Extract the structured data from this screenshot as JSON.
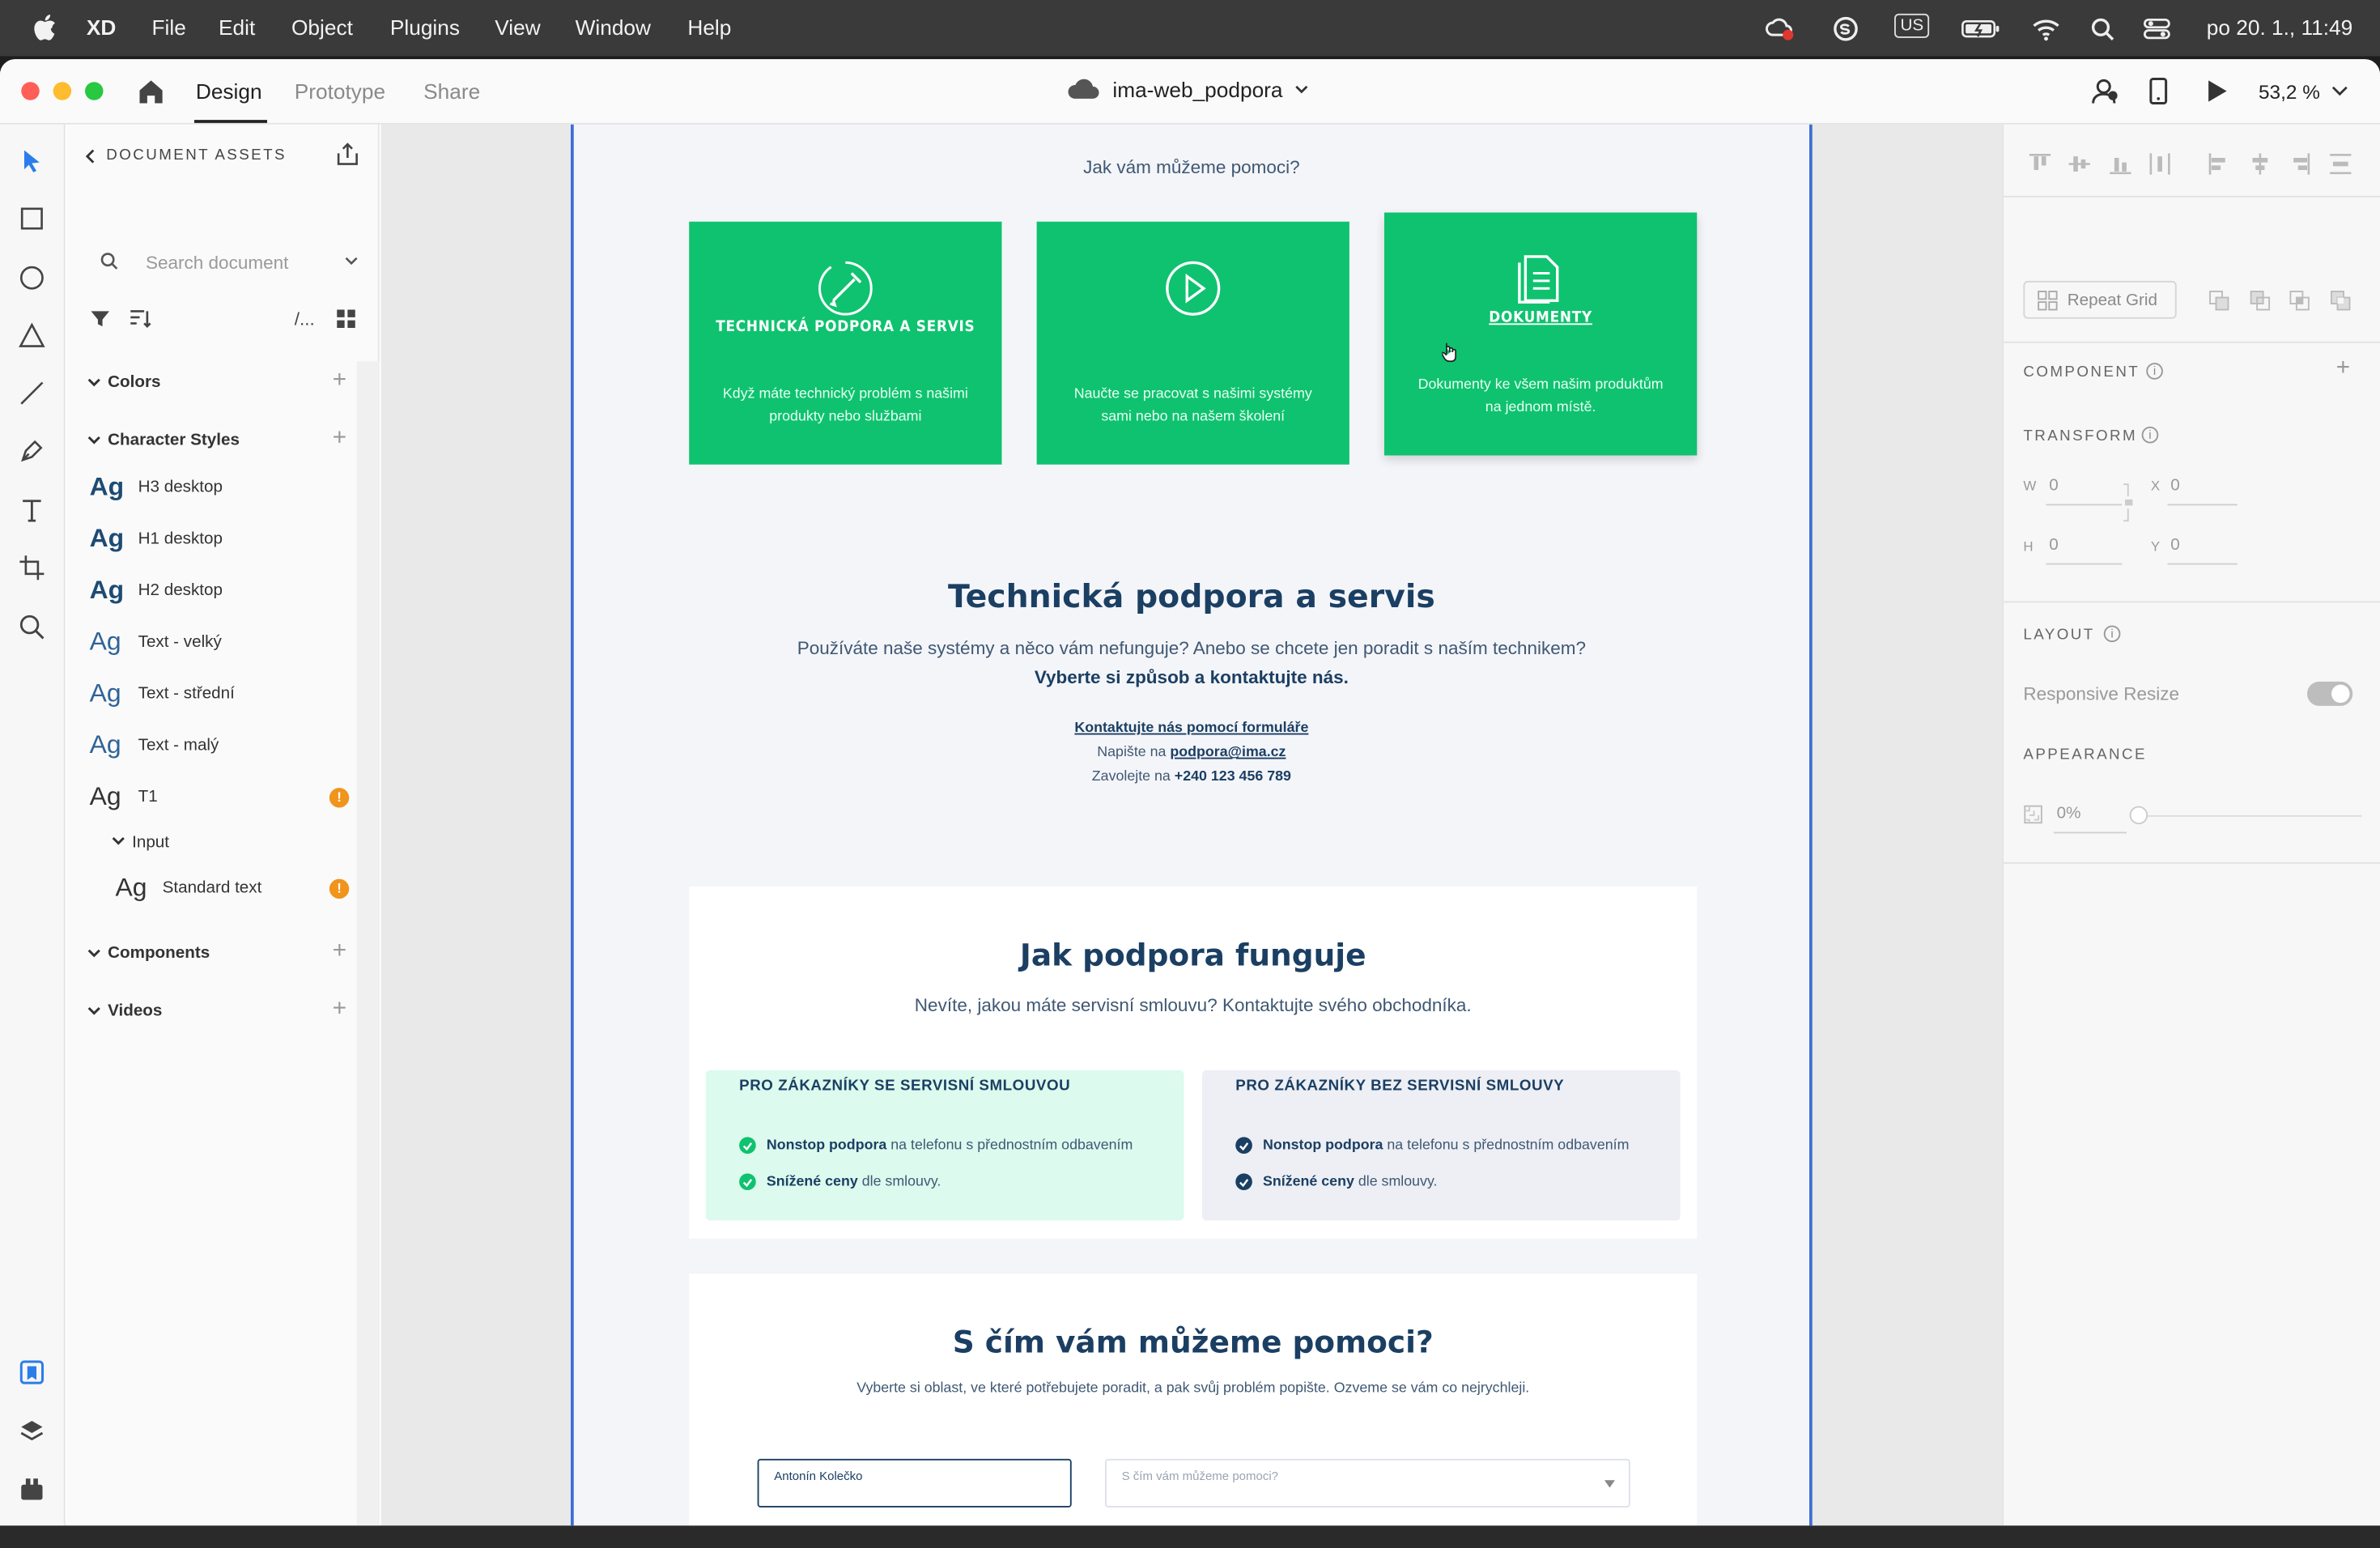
{
  "menubar": {
    "app": "XD",
    "items": [
      "File",
      "Edit",
      "Object",
      "Plugins",
      "View",
      "Window",
      "Help"
    ],
    "keyboard": "US",
    "clock": "po 20. 1., 11:49"
  },
  "titlebar": {
    "tabs": [
      "Design",
      "Prototype",
      "Share"
    ],
    "active_tab": "Design",
    "document_name": "ima-web_podpora",
    "zoom": "53,2 %"
  },
  "assets": {
    "header": "DOCUMENT ASSETS",
    "search_placeholder": "Search document",
    "sections": {
      "colors": "Colors",
      "character_styles": "Character Styles",
      "components": "Components",
      "videos": "Videos"
    },
    "styles": [
      {
        "ag": "Ag",
        "name": "H3 desktop",
        "weight": "bold",
        "warn": false
      },
      {
        "ag": "Ag",
        "name": "H1 desktop",
        "weight": "bold",
        "warn": false
      },
      {
        "ag": "Ag",
        "name": "H2 desktop",
        "weight": "bold",
        "warn": false
      },
      {
        "ag": "Ag",
        "name": "Text - velký",
        "weight": "light",
        "warn": false
      },
      {
        "ag": "Ag",
        "name": "Text - střední",
        "weight": "light",
        "warn": false
      },
      {
        "ag": "Ag",
        "name": "Text - malý",
        "weight": "light",
        "warn": false
      },
      {
        "ag": "Ag",
        "name": "T1",
        "weight": "normal",
        "warn": true
      }
    ],
    "group_input": "Input",
    "standard_text": {
      "ag": "Ag",
      "name": "Standard text",
      "warn": true
    }
  },
  "artboard": {
    "intro": "Jak vám můžeme pomoci?",
    "tiles": [
      {
        "title": "TECHNICKÁ PODPORA A SERVIS",
        "desc": "Když máte technický problém s našimi produkty nebo službami",
        "icon": "wrench-screwdriver-icon"
      },
      {
        "title": "",
        "desc": "Naučte se pracovat s našimi systémy sami nebo na našem školení",
        "icon": "play-circle-icon"
      },
      {
        "title": "DOKUMENTY",
        "desc": "Dokumenty ke všem našim produktům na jednom místě.",
        "icon": "documents-icon"
      }
    ],
    "support": {
      "heading": "Technická podpora a servis",
      "line1": "Používáte naše systémy a něco vám nefunguje? Anebo se chcete jen poradit s naším technikem?",
      "line2": "Vyberte si způsob a kontaktujte nás.",
      "form_link": "Kontaktujte nás pomocí formuláře",
      "write_prefix": "Napište na",
      "email": "podpora@ima.cz",
      "call_prefix": "Zavolejte na",
      "phone": "+240 123 456 789"
    },
    "how": {
      "heading": "Jak podpora funguje",
      "sub": "Nevíte, jakou máte servisní smlouvu? Kontaktujte svého obchodníka.",
      "with": {
        "title": "PRO ZÁKAZNÍKY SE SERVISNÍ SMLOUVOU",
        "item1_bold": "Nonstop podpora",
        "item1_rest": "na telefonu s přednostním odbavením",
        "item2_bold": "Snížené ceny",
        "item2_rest": "dle smlouvy."
      },
      "without": {
        "title": "PRO ZÁKAZNÍKY BEZ SERVISNÍ SMLOUVY",
        "item1_bold": "Nonstop podpora",
        "item1_rest": "na telefonu s přednostním odbavením",
        "item2_bold": "Snížené ceny",
        "item2_rest": "dle smlouvy."
      }
    },
    "help": {
      "heading": "S čím vám můžeme pomoci?",
      "sub": "Vyberte si oblast, ve které potřebujete poradit, a pak svůj problém popište. Ozveme se vám co nejrychleji.",
      "name_value": "Antonín Kolečko",
      "select_placeholder": "S čím vám můžeme pomoci?"
    }
  },
  "props": {
    "repeat_grid": "Repeat Grid",
    "component": "COMPONENT",
    "transform": "TRANSFORM",
    "w_label": "W",
    "w": "0",
    "x_label": "X",
    "x": "0",
    "h_label": "H",
    "h": "0",
    "y_label": "Y",
    "y": "0",
    "layout": "LAYOUT",
    "responsive_resize": "Responsive Resize",
    "appearance": "APPEARANCE",
    "opacity": "0%"
  },
  "colors": {
    "accent_green": "#0fc26f",
    "navy": "#1b3f63",
    "selection_blue": "#3d6fd6"
  }
}
